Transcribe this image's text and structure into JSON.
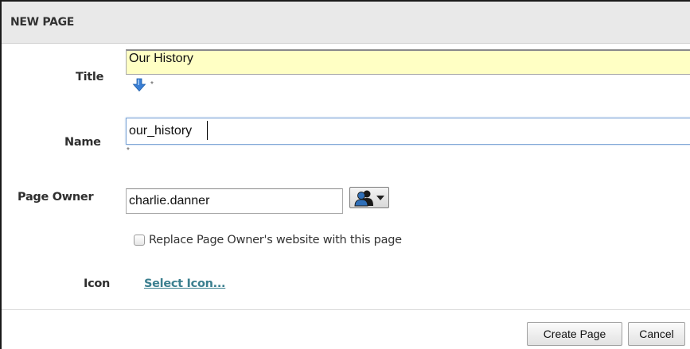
{
  "dialog": {
    "title": "NEW PAGE"
  },
  "form": {
    "title": {
      "label": "Title",
      "value": "Our History",
      "required_mark": "*",
      "copy_icon": "arrow-down-icon"
    },
    "name": {
      "label": "Name",
      "value": "our_history",
      "required_mark": "*"
    },
    "page_owner": {
      "label": "Page Owner",
      "value": "charlie.danner",
      "picker_icon": "people-icon"
    },
    "replace_website": {
      "label": "Replace Page Owner's website with this page",
      "checked": false
    },
    "icon": {
      "label": "Icon",
      "link_text": "Select Icon..."
    }
  },
  "footer": {
    "create_label": "Create Page",
    "cancel_label": "Cancel"
  },
  "colors": {
    "header_bg": "#e9e9e9",
    "title_input_bg": "#ffffc4",
    "link": "#3b7f8f",
    "arrow": "#3a7fd5"
  }
}
